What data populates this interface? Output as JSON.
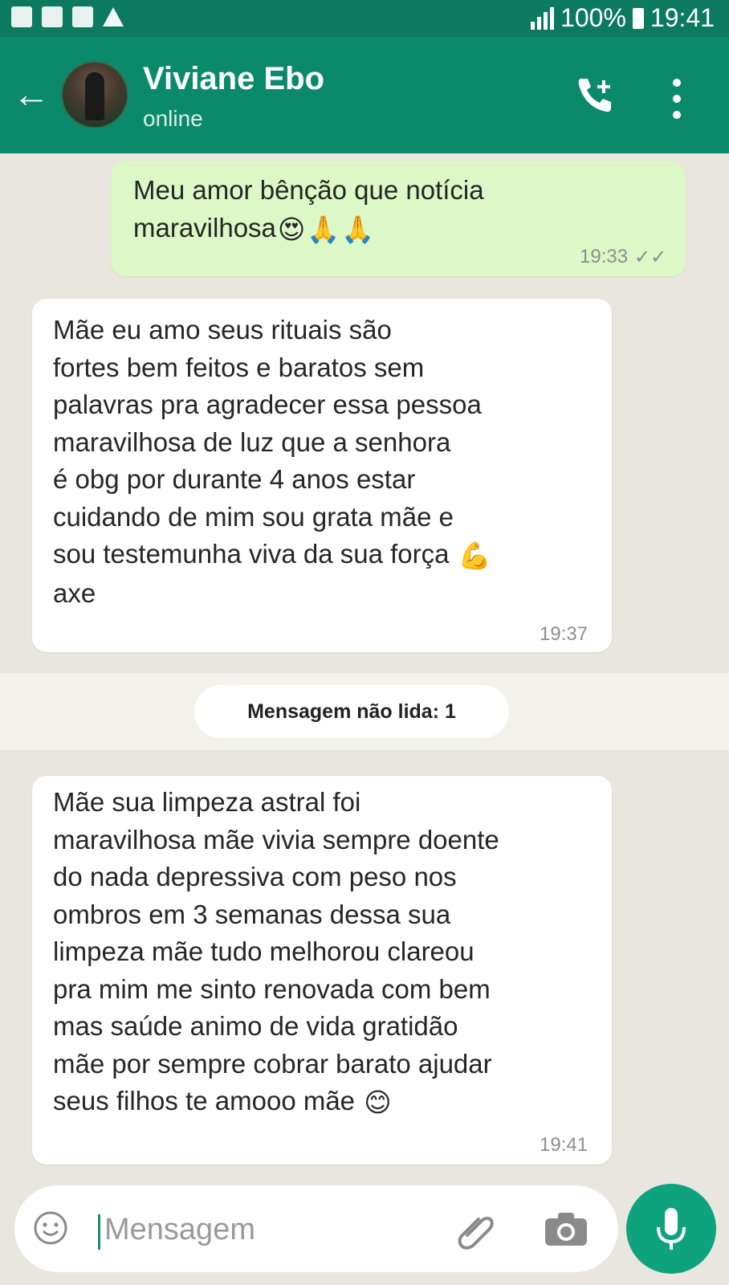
{
  "status_bar": {
    "battery": "100%",
    "time": "19:41"
  },
  "header": {
    "back_icon": "arrow-left-icon",
    "contact_name": "Viviane Ebo",
    "contact_status": "online",
    "call_icon": "add-call-icon",
    "menu_icon": "more-vertical-icon"
  },
  "messages": [
    {
      "direction": "outgoing",
      "text_lines": [
        "Meu amor bênção que notícia",
        "maravilhosa"
      ],
      "emojis": [
        "😍",
        "🙏",
        "🙏"
      ],
      "time": "19:33",
      "ticks": "✓✓"
    },
    {
      "direction": "incoming",
      "text_lines": [
        "Mãe eu amo seus rituais são",
        "fortes bem feitos e baratos sem",
        "palavras pra agradecer essa pessoa",
        "maravilhosa de luz que a senhora",
        "é obg por durante 4 anos estar",
        "cuidando de mim sou grata mãe e",
        "sou testemunha viva da sua força",
        "axe"
      ],
      "emoji": "💪",
      "time": "19:37"
    },
    {
      "direction": "incoming",
      "text_lines": [
        "Mãe sua limpeza astral foi",
        "maravilhosa mãe vivia sempre doente",
        "do nada depressiva com peso nos",
        "ombros em 3 semanas dessa sua",
        "limpeza mãe tudo melhorou clareou",
        "pra mim me sinto renovada com bem",
        "mas saúde animo de vida gratidão",
        "mãe por sempre cobrar barato ajudar",
        "seus  filhos te amooo mãe"
      ],
      "emoji": "😊",
      "time": "19:41"
    }
  ],
  "unread_label": "Mensagem não lida: 1",
  "composer": {
    "placeholder": "Mensagem",
    "emoji_icon": "smiley-icon",
    "attach_icon": "paperclip-icon",
    "camera_icon": "camera-icon",
    "mic_icon": "microphone-icon"
  },
  "colors": {
    "header": "#0b8a6b",
    "status_bar": "#0b7a5e",
    "chat_bg": "#e9e6df",
    "outgoing_bubble": "#dcf8c6",
    "incoming_bubble": "#ffffff",
    "mic_button": "#0ea37c"
  }
}
